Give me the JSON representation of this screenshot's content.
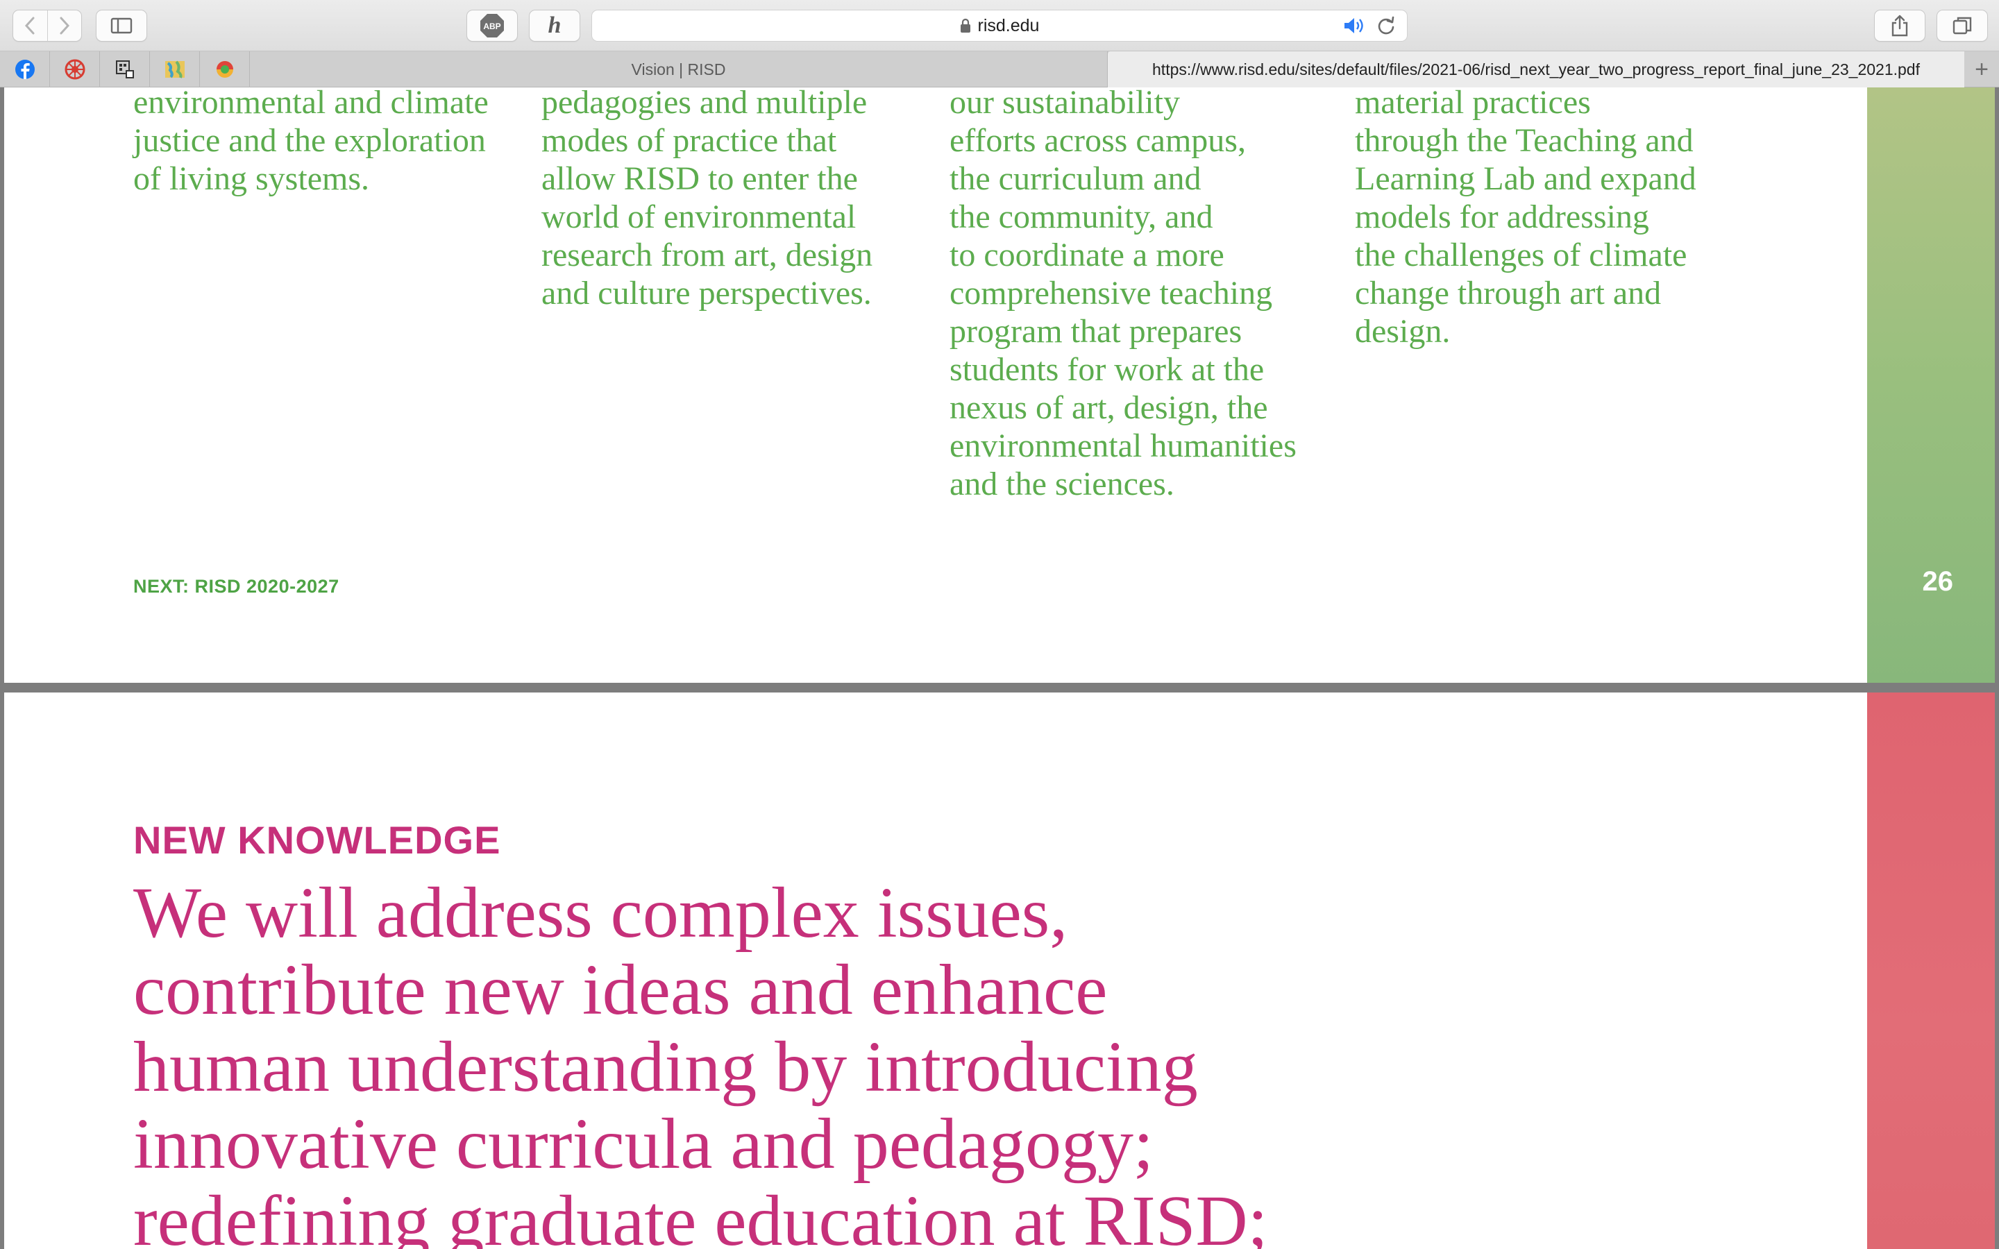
{
  "browser": {
    "url_display": "risd.edu",
    "tabs": [
      {
        "title": "Vision | RISD",
        "active": false
      },
      {
        "title": "https://www.risd.edu/sites/default/files/2021-06/risd_next_year_two_progress_report_final_june_23_2021.pdf",
        "active": true
      }
    ],
    "favorites": [
      "facebook-icon",
      "bookmark-red-icon",
      "bookmark-grid-icon",
      "bookmark-map-icon",
      "bookmark-circle-icon"
    ],
    "toolbar_icons": {
      "abp_label": "ABP",
      "honey_label": "h"
    }
  },
  "pdf": {
    "page_26": {
      "columns": [
        [
          "environmental and climate",
          "justice and the exploration",
          "of living systems."
        ],
        [
          "pedagogies and multiple",
          "modes of practice that",
          "allow RISD to enter the",
          "world of environmental",
          "research from art, design",
          "and culture perspectives."
        ],
        [
          "our sustainability",
          "efforts across campus,",
          "the curriculum and",
          "the community, and",
          "to coordinate a more",
          "comprehensive teaching",
          "program that prepares",
          "students for work at the",
          "nexus of art, design, the",
          "environmental humanities",
          "and the sciences."
        ],
        [
          "material practices",
          "through the Teaching and",
          "Learning Lab and expand",
          "models for addressing",
          "the challenges of climate",
          "change through art and",
          "design."
        ]
      ],
      "footer": "NEXT: RISD 2020-2027",
      "page_number": "26",
      "accent_color": "#5cac4e"
    },
    "page_27": {
      "section_title": "NEW KNOWLEDGE",
      "headline_lines": [
        "We will address complex issues,",
        "contribute new ideas and enhance",
        "human understanding by introducing",
        "innovative curricula and pedagogy;",
        "redefining graduate education at RISD;"
      ],
      "accent_color": "#c6307a"
    }
  }
}
